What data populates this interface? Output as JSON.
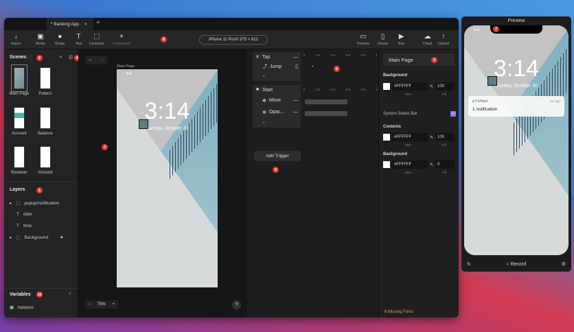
{
  "app": {
    "tab_title": "* Banking App",
    "new_tab": "+",
    "close": "×"
  },
  "toolbar": {
    "tools": [
      {
        "label": "Import",
        "icon": "import-icon"
      },
      {
        "label": "Media",
        "icon": "media-icon"
      },
      {
        "label": "Shape",
        "icon": "shape-icon"
      },
      {
        "label": "Text",
        "icon": "text-icon"
      },
      {
        "label": "Container",
        "icon": "container-icon"
      },
      {
        "label": "Component",
        "icon": "component-icon"
      }
    ],
    "device": "iPhone 11 Pro/X  375 × 812",
    "right_tools": [
      {
        "label": "Preview",
        "icon": "preview-icon"
      },
      {
        "label": "Device",
        "icon": "device-icon"
      },
      {
        "label": "Run",
        "icon": "run-icon"
      },
      {
        "label": "Cloud",
        "icon": "cloud-icon"
      },
      {
        "label": "Upload",
        "icon": "upload-icon"
      }
    ]
  },
  "badges": [
    "1",
    "2",
    "3",
    "4",
    "5",
    "6",
    "7",
    "8",
    "9",
    "10"
  ],
  "scenes": {
    "title": "Scenes",
    "add": "+",
    "items": [
      "Main Page",
      "Pattern",
      "Account",
      "Balance",
      "Receiver",
      "Amount"
    ]
  },
  "layers": {
    "title": "Layers",
    "items": [
      {
        "name": "popup/notification",
        "type": "container"
      },
      {
        "name": "date",
        "type": "text"
      },
      {
        "name": "time",
        "type": "text"
      },
      {
        "name": "Background",
        "type": "container",
        "locked": true
      }
    ]
  },
  "variables": {
    "title": "Variables",
    "add": "+",
    "items": [
      "balance"
    ]
  },
  "canvas": {
    "scene_label": "Main Page",
    "time": "3:14",
    "date": "Sunday, October 30",
    "carrier": "Bell",
    "zoom": "75%",
    "minus": "−",
    "plus": "+",
    "help": "?"
  },
  "timeline": {
    "ruler": [
      "0",
      "0.2",
      "0.4",
      "0.6",
      "0.8",
      "1"
    ],
    "triggers": [
      {
        "name": "Tap",
        "responses": [
          "Jump"
        ]
      },
      {
        "name": "Start",
        "responses": [
          "Move",
          "Opac..."
        ]
      }
    ],
    "add_trigger": "Add Trigger"
  },
  "props": {
    "scene": "Main Page",
    "background_label": "Background",
    "bg_hex": "#FFFFFF",
    "bg_fill": "100",
    "hex_label": "HEX",
    "fill_label": "Fill",
    "status_bar_label": "System Status Bar",
    "status_bar_checked": true,
    "contents_label": "Contents",
    "contents_hex": "#FFFFFF",
    "contents_fill": "100",
    "sb_background_label": "Background",
    "sb_bg_hex": "#FFFFFF",
    "sb_bg_fill": "0",
    "missing_fonts": "6 Missing Fonts"
  },
  "preview": {
    "title": "Preview",
    "time": "3:14",
    "date": "Sunday, October 30",
    "carrier": "Bell",
    "notif_app": "PieBank",
    "notif_time": "4m ago",
    "notif_text": "1 notification",
    "record": "Record"
  },
  "colors": {
    "badge": "#e53a2a",
    "accent": "#8a7cf0",
    "warning": "#e0a030"
  }
}
